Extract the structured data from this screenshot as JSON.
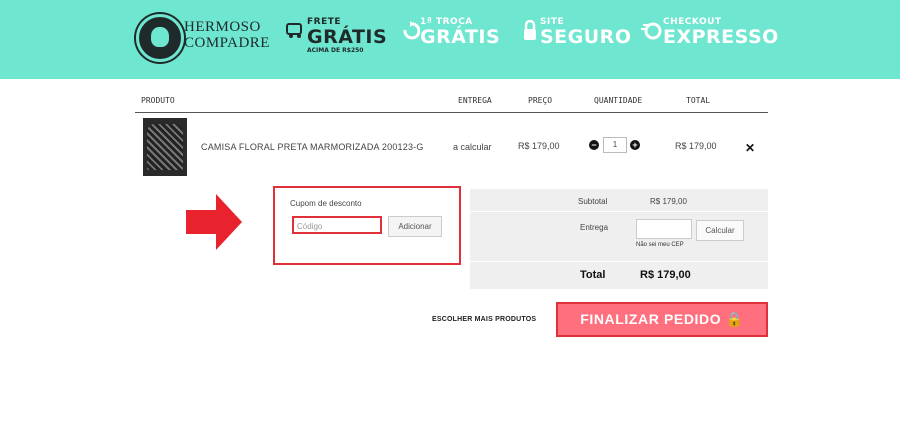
{
  "header": {
    "brand": {
      "line1": "HERMOSO",
      "line2": "COMPADRE"
    },
    "perks": [
      {
        "small": "FRETE",
        "big": "GRÁTIS",
        "tiny": "ACIMA DE R$250"
      },
      {
        "small": "1ª TROCA",
        "big": "GRÁTIS"
      },
      {
        "small": "SITE",
        "big": "SEGURO"
      },
      {
        "small": "CHECKOUT",
        "big": "EXPRESSO"
      }
    ]
  },
  "cart": {
    "columns": [
      "PRODUTO",
      "ENTREGA",
      "PREÇO",
      "QUANTIDADE",
      "TOTAL"
    ],
    "items": [
      {
        "name": "CAMISA FLORAL PRETA MARMORIZADA 200123-G",
        "delivery": "a calcular",
        "price": "R$ 179,00",
        "qty": "1",
        "total": "R$ 179,00"
      }
    ],
    "remove_icon": "close-icon"
  },
  "coupon": {
    "title": "Cupom de desconto",
    "placeholder": "Código",
    "button": "Adicionar"
  },
  "summary": {
    "subtotal_label": "Subtotal",
    "subtotal_value": "R$ 179,00",
    "shipping_label": "Entrega",
    "calc_button": "Calcular",
    "cep_help": "Não sei meu CEP",
    "total_label": "Total",
    "total_value": "R$ 179,00"
  },
  "actions": {
    "more_products": "ESCOLHER MAIS PRODUTOS",
    "checkout": "FINALIZAR PEDIDO 🔒"
  },
  "colors": {
    "topbar": "#6fe6d0",
    "accent_red": "#e0303a",
    "checkout_btn": "#ff6f7d"
  }
}
